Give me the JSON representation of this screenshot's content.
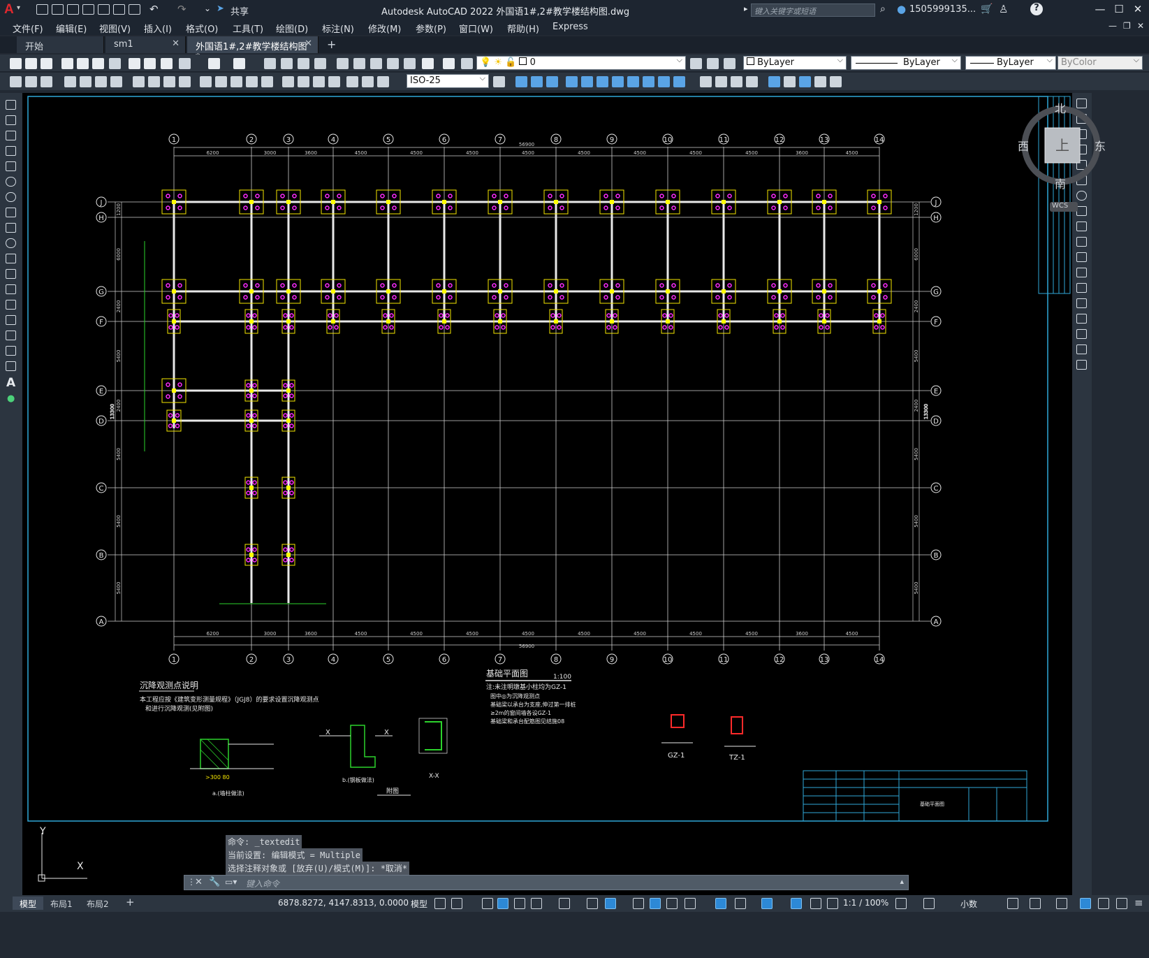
{
  "app": {
    "title": "Autodesk AutoCAD 2022    外国语1#,2#教学楼结构图.dwg",
    "share_label": "共享",
    "search_placeholder": "键入关键字或短语",
    "user": "1505999135...",
    "logo": "A"
  },
  "menus": [
    "文件(F)",
    "编辑(E)",
    "视图(V)",
    "插入(I)",
    "格式(O)",
    "工具(T)",
    "绘图(D)",
    "标注(N)",
    "修改(M)",
    "参数(P)",
    "窗口(W)",
    "帮助(H)",
    "Express"
  ],
  "file_tabs": [
    {
      "label": "开始"
    },
    {
      "label": "sm1"
    },
    {
      "label": "外国语1#,2#教学楼结构图*"
    }
  ],
  "toolbar": {
    "layer_value": "0",
    "color_value": "ByLayer",
    "linetype_value": "ByLayer",
    "lineweight_value": "ByLayer",
    "plotstyle_value": "ByColor",
    "dimstyle_value": "ISO-25"
  },
  "viewcube": {
    "north": "北",
    "south": "南",
    "east": "东",
    "west": "西",
    "face": "上",
    "wcs": "WCS"
  },
  "drawing": {
    "top_axes": [
      "1",
      "2",
      "3",
      "4",
      "5",
      "6",
      "7",
      "8",
      "9",
      "10",
      "11",
      "12",
      "13",
      "14"
    ],
    "row_axes": [
      "J",
      "H",
      "G",
      "F",
      "E",
      "D",
      "C",
      "B",
      "A"
    ],
    "top_dims": [
      "6200",
      "3000",
      "3600",
      "4500",
      "4500",
      "4500",
      "4500",
      "4500",
      "4500",
      "4500",
      "4500",
      "3600",
      "4500"
    ],
    "total_dim": "56900",
    "left_dims": [
      "1200",
      "6000",
      "2400",
      "5400",
      "2400",
      "5400",
      "5400",
      "5400"
    ],
    "left_total": "13300",
    "title_main": "基础平面图",
    "title_scale": "1:100",
    "notes_title": "沉降观测点说明",
    "notes_text1": "本工程应按《建筑变形测量规程》（JGJ8）的要求设置沉降观测点",
    "notes_text2": "和进行沉降观测(见附图)",
    "plan_note1": "注:未注明墩基小柱均为GZ-1",
    "plan_note2": "图中◎为沉降观测点",
    "plan_note3": "基础梁以承台为支座,伸过第一排桩",
    "plan_note4": "≥2m的窗间墙各设GZ-1",
    "plan_note5": "基础梁和承台配筋图见结施08",
    "label_attach": "附图",
    "label_xx": "X-X",
    "label_gz": "GZ-1",
    "label_tz": "TZ-1",
    "label_a": "a.(墙柱做法)",
    "label_b": "b.(钢板做法)",
    "titleblock_text": "基础平面图"
  },
  "command": {
    "history": [
      "命令: _textedit",
      "当前设置: 编辑模式 = Multiple",
      "选择注释对象或 [放弃(U)/模式(M)]: *取消*"
    ],
    "placeholder": "键入命令"
  },
  "ucs": {
    "x": "X",
    "y": "Y"
  },
  "status": {
    "layout_tabs": [
      "模型",
      "布局1",
      "布局2"
    ],
    "coords": "6878.8272, 4147.8313, 0.0000",
    "model_label": "模型",
    "scale": "1:1 / 100%",
    "units": "小数"
  }
}
